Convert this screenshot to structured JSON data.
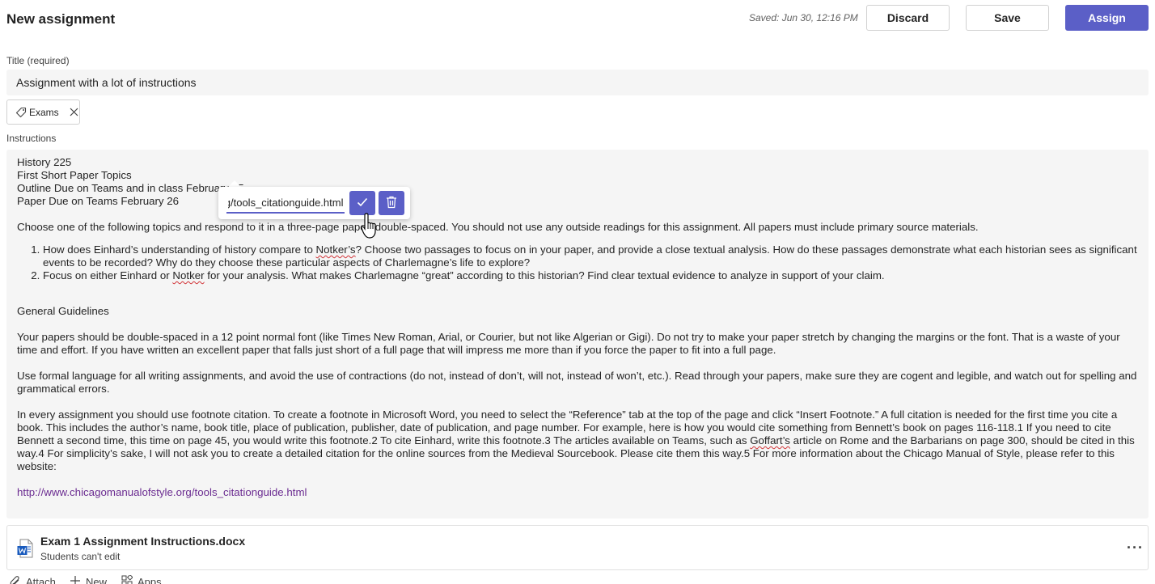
{
  "header": {
    "title": "New assignment",
    "saved_status": "Saved: Jun 30, 12:16 PM",
    "discard_label": "Discard",
    "save_label": "Save",
    "assign_label": "Assign",
    "accent_color": "#5b5fc7"
  },
  "title_field": {
    "label": "Title (required)",
    "value": "Assignment with a lot of instructions"
  },
  "tag": {
    "label": "Exams",
    "icon": "tag-icon"
  },
  "instructions": {
    "label": "Instructions",
    "line1": "History 225",
    "line2": "First Short Paper Topics",
    "line3": "Outline Due on Teams and in class February 15",
    "line4": "Paper Due on Teams February 26",
    "intro": "Choose one of the following topics and respond to it in a three-page paper, double-spaced.  You should not use any outside readings for this assignment. All papers must include primary source materials.",
    "item1_a": "How does Einhard’s understanding of history compare to ",
    "item1_b": "Notker’s",
    "item1_c": "? Choose two passages to focus on in your paper, and provide a close textual analysis. How do these passages demonstrate what each historian sees as significant events to be recorded? Why do they choose these particular aspects of Charlemagne’s life to explore?",
    "item2_a": "Focus on either Einhard or ",
    "item2_b": "Notker",
    "item2_c": " for your analysis. What makes Charlemagne “great” according to this historian? Find clear textual evidence to analyze in support of your claim.",
    "guidelines_heading": "General Guidelines",
    "para1": "Your papers should be double-spaced in a 12 point normal font (like Times New Roman, Arial, or Courier, but not like Algerian or Gigi).  Do not try to make your paper stretch by changing the margins or the font.  That is a waste of your time and effort.  If you have written an excellent paper that falls just short of a full page that will impress me more than if you force the paper to fit into a full page.",
    "para2": "Use formal language for all writing assignments, and avoid the use of contractions (do not, instead of don’t, will not, instead of won’t, etc.).  Read through your papers, make sure they are cogent and legible, and watch out for spelling and grammatical errors.",
    "para3_a": "In every assignment you should use footnote citation. To create a footnote in Microsoft Word, you need to select the “Reference” tab at the top of the page and click “Insert Footnote.” A full citation is needed for the first time you cite a book. This includes the author’s name, book title, place of publication, publisher, date of publication, and page number. For example, here is how you would cite something from Bennett’s book on pages 116-118.1 If you need to cite Bennett a second time, this time on page 45, you would write this footnote.2 To cite Einhard, write this footnote.3 The articles available on Teams, such as ",
    "para3_b": "Goffart’s",
    "para3_c": " article on Rome and the Barbarians on page 300, should be cited in this way.4 For simplicity’s sake, I will not ask you to create a detailed citation for the online sources from the Medieval Sourcebook. Please cite them this way.5 For more information about the Chicago Manual of Style, please refer to this website:",
    "link": "http://www.chicagomanualofstyle.org/tools_citationguide.html"
  },
  "link_popup": {
    "value": "http://www.chicagomanualofstyle.org/tools_citationguide.html",
    "confirm_icon": "checkmark-icon",
    "delete_icon": "trash-icon"
  },
  "attachment": {
    "name": "Exam 1 Assignment Instructions.docx",
    "permission": "Students can't edit",
    "icon": "word-icon",
    "more_label": "···"
  },
  "toolbar": {
    "attach_label": "Attach",
    "new_label": "New",
    "apps_label": "Apps"
  }
}
